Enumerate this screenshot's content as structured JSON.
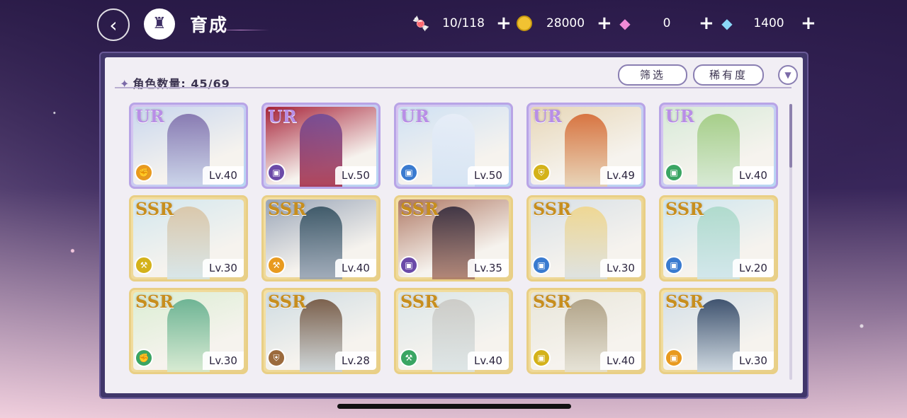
{
  "header": {
    "title": "育成",
    "back_icon": "back-arrow-icon",
    "home_icon": "castle-home-icon"
  },
  "resources": {
    "candy": {
      "icon": "candy-icon",
      "value": "10/118"
    },
    "gold": {
      "icon": "gold-coin-icon",
      "value": "28000"
    },
    "pink_gem": {
      "icon": "pink-diamond-icon",
      "value": "0"
    },
    "blue_gem": {
      "icon": "blue-diamond-icon",
      "value": "1400"
    },
    "plus": "+"
  },
  "panel": {
    "count_label": "角色数量: 45/69",
    "filter_label": "筛选",
    "rarity_label": "稀有度",
    "sort_icon": "chevron-down-icon"
  },
  "cards": [
    {
      "rarity": "UR",
      "level": "Lv.40",
      "role": "orange",
      "role_icon": "fist-icon"
    },
    {
      "rarity": "UR",
      "level": "Lv.50",
      "role": "purple",
      "role_icon": "book-icon"
    },
    {
      "rarity": "UR",
      "level": "Lv.50",
      "role": "blue",
      "role_icon": "book-icon"
    },
    {
      "rarity": "UR",
      "level": "Lv.49",
      "role": "yellow",
      "role_icon": "shield-icon"
    },
    {
      "rarity": "UR",
      "level": "Lv.40",
      "role": "green",
      "role_icon": "book-icon"
    },
    {
      "rarity": "SSR",
      "level": "Lv.30",
      "role": "yellow",
      "role_icon": "hammer-icon"
    },
    {
      "rarity": "SSR",
      "level": "Lv.40",
      "role": "orange",
      "role_icon": "hammer-icon"
    },
    {
      "rarity": "SSR",
      "level": "Lv.35",
      "role": "purple",
      "role_icon": "book-icon"
    },
    {
      "rarity": "SSR",
      "level": "Lv.30",
      "role": "blue",
      "role_icon": "book-icon"
    },
    {
      "rarity": "SSR",
      "level": "Lv.20",
      "role": "blue",
      "role_icon": "book-icon"
    },
    {
      "rarity": "SSR",
      "level": "Lv.30",
      "role": "green",
      "role_icon": "fist-icon"
    },
    {
      "rarity": "SSR",
      "level": "Lv.28",
      "role": "brown",
      "role_icon": "shield-icon"
    },
    {
      "rarity": "SSR",
      "level": "Lv.40",
      "role": "green",
      "role_icon": "hammer-icon"
    },
    {
      "rarity": "SSR",
      "level": "Lv.40",
      "role": "yellow",
      "role_icon": "book-icon"
    },
    {
      "rarity": "SSR",
      "level": "Lv.30",
      "role": "orange",
      "role_icon": "book-icon"
    }
  ],
  "colors": {
    "ur_border": "#b8a4e6",
    "ssr_border": "#e9cf85",
    "role_orange": "#e89a1f",
    "role_purple": "#6b4aa8",
    "role_blue": "#3a7bd0",
    "role_yellow": "#d4b21a",
    "role_green": "#3aa563",
    "role_brown": "#9b6a3c"
  }
}
